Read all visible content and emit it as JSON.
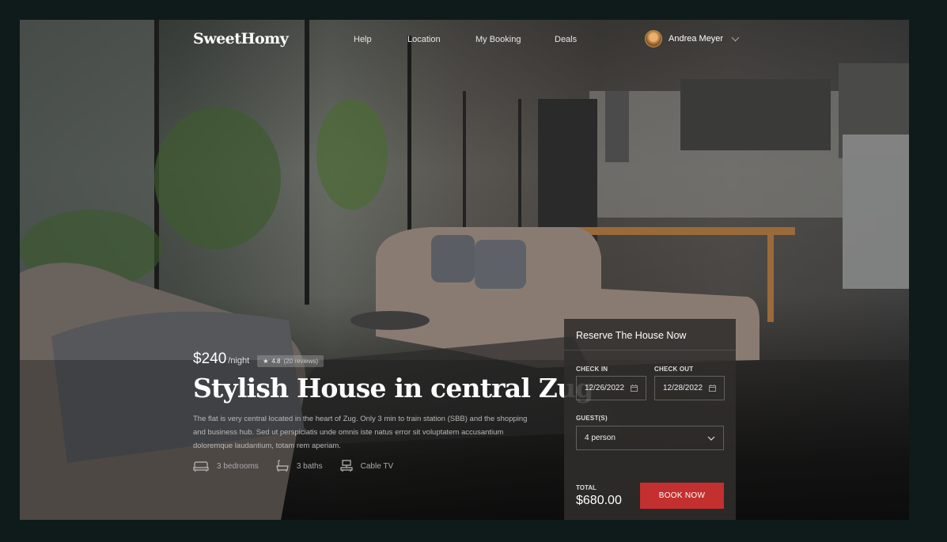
{
  "brand": {
    "logo": "SweetHomy"
  },
  "nav": {
    "help": "Help",
    "location": "Location",
    "booking": "My Booking",
    "deals": "Deals"
  },
  "user": {
    "name": "Andrea Meyer"
  },
  "listing": {
    "price": "$240",
    "per_night": "/night",
    "rating": "4.8",
    "reviews": "(20 reviews)",
    "title": "Stylish House in central Zug",
    "description": "The flat is very central located in the heart of Zug. Only 3 min to train station (SBB) and the shopping and business hub. Sed ut perspiciatis unde omnis iste natus error sit voluptatem accusantium doloremque laudantium, totam rem aperiam.",
    "features": [
      {
        "icon": "bed-icon",
        "label": "3 bedrooms"
      },
      {
        "icon": "bath-icon",
        "label": "3 baths"
      },
      {
        "icon": "tv-icon",
        "label": "Cable TV"
      }
    ]
  },
  "reservation": {
    "title": "Reserve The House Now",
    "check_in_label": "CHECK IN",
    "check_in_value": "12/26/2022",
    "check_out_label": "CHECK OUT",
    "check_out_value": "12/28/2022",
    "guests_label": "GUEST(S)",
    "guests_value": "4 person",
    "total_label": "TOTAL",
    "total_value": "$680.00",
    "book_button": "BOOK NOW"
  },
  "colors": {
    "accent": "#c42f2f",
    "background": "#0f1a1a"
  }
}
